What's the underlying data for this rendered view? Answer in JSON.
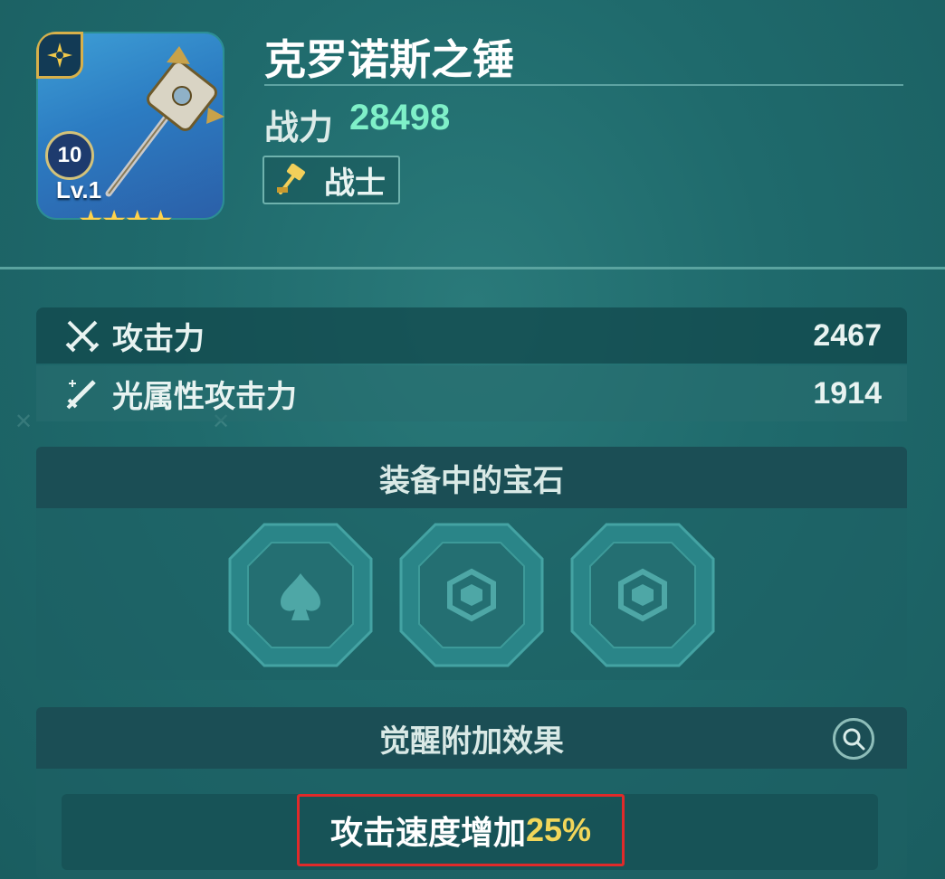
{
  "item": {
    "name": "克罗诺斯之锤",
    "power_label": "战力",
    "power_value": "28498",
    "class_label": "战士",
    "level_badge": "10",
    "level_text": "Lv.1",
    "stars": 4
  },
  "stats": [
    {
      "label": "攻击力",
      "value": "2467",
      "icon": "crossed-swords-icon"
    },
    {
      "label": "光属性攻击力",
      "value": "1914",
      "icon": "light-sword-icon"
    }
  ],
  "gems": {
    "title": "装备中的宝石",
    "slots": [
      {
        "icon": "spade-gem-icon"
      },
      {
        "icon": "hexagon-gem-icon"
      },
      {
        "icon": "hexagon-gem-icon"
      }
    ]
  },
  "awaken": {
    "title": "觉醒附加效果",
    "effect_prefix": "攻击速度增加",
    "effect_value": "25%"
  },
  "colors": {
    "power": "#7ff0c8",
    "highlight": "#f2d65a",
    "annotation_box": "#e02a2a"
  }
}
